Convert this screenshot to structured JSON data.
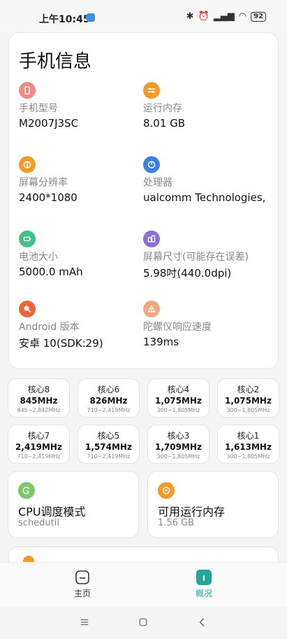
{
  "status_bar": {
    "time": "上午10:45",
    "battery": "92"
  },
  "info": {
    "title": "手机信息",
    "items": [
      {
        "label": "手机型号",
        "value": "M2007J3SC",
        "icon": "phone-icon",
        "color": "#f28b85"
      },
      {
        "label": "运行内存",
        "value": "8.01 GB",
        "icon": "memory-icon",
        "color": "#f29b2b"
      },
      {
        "label": "屏幕分辨率",
        "value": "2400*1080",
        "icon": "resolution-icon",
        "color": "#f29b2b"
      },
      {
        "label": "处理器",
        "value": "ualcomm Technologies,",
        "icon": "processor-icon",
        "color": "#3b82e0"
      },
      {
        "label": "电池大小",
        "value": "5000.0 mAh",
        "icon": "battery-icon",
        "color": "#3ec28a"
      },
      {
        "label": "屏幕尺寸(可能存在误差)",
        "value": "5.98吋(440.0dpi)",
        "icon": "screen-size-icon",
        "color": "#8a6fd1"
      },
      {
        "label": "Android 版本",
        "value": "安卓 10(SDK:29)",
        "icon": "android-icon",
        "color": "#f0643a"
      },
      {
        "label": "陀螺仪响应速度",
        "value": "139ms",
        "icon": "gyroscope-icon",
        "color": "#f1a982"
      }
    ]
  },
  "cores": [
    {
      "name": "核心8",
      "freq": "845MHz",
      "range": "845~2,842MHz"
    },
    {
      "name": "核心6",
      "freq": "826MHz",
      "range": "710~2,419MHz"
    },
    {
      "name": "核心4",
      "freq": "1,075MHz",
      "range": "300~1,805MHz"
    },
    {
      "name": "核心2",
      "freq": "1,075MHz",
      "range": "300~1,805MHz"
    },
    {
      "name": "核心7",
      "freq": "2,419MHz",
      "range": "710~2,419MHz"
    },
    {
      "name": "核心5",
      "freq": "1,574MHz",
      "range": "710~2,419MHz"
    },
    {
      "name": "核心3",
      "freq": "1,709MHz",
      "range": "300~1,805MHz"
    },
    {
      "name": "核心1",
      "freq": "1,613MHz",
      "range": "300~1,805MHz"
    }
  ],
  "cards": {
    "cpu": {
      "title": "CPU调度模式",
      "value": "schedutil",
      "icon": "cpu-governor-icon",
      "color": "#7cc86a"
    },
    "ram": {
      "title": "可用运行内存",
      "value": "1.56 GB",
      "icon": "available-memory-icon",
      "color": "#f29b2b"
    }
  },
  "tabs": [
    {
      "label": "主页",
      "icon": "home-icon",
      "active": false
    },
    {
      "label": "概况",
      "icon": "overview-icon",
      "active": true
    }
  ],
  "colors": {
    "accent": "#26a69a",
    "text": "#111111",
    "muted": "#888888"
  }
}
